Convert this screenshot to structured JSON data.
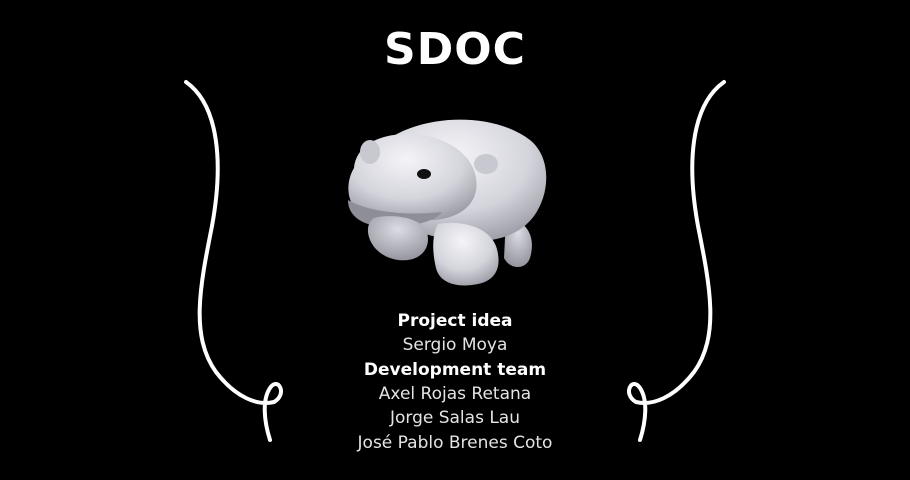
{
  "app": {
    "title": "SDOC"
  },
  "credits": {
    "project_idea_heading": "Project idea",
    "project_idea_names": [
      "Sergio Moya"
    ],
    "development_team_heading": "Development team",
    "development_team_names": [
      "Axel Rojas Retana",
      "Jorge Salas Lau",
      "José Pablo Brenes Coto"
    ]
  },
  "colors": {
    "background": "#000000",
    "text": "#ffffff",
    "mascot": "#e6e6ec"
  },
  "icons": {
    "mascot": "polar-bear-mascot",
    "decoration_left": "swirl-ornament",
    "decoration_right": "swirl-ornament"
  }
}
